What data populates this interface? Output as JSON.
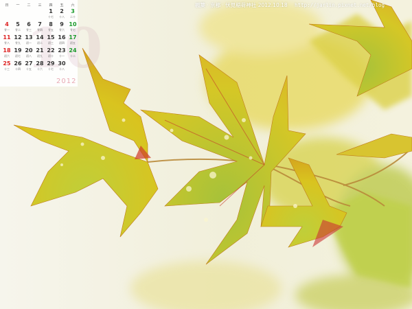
{
  "caption": {
    "location": "楓葉 · 京都 · 伏見稲荷神社",
    "date": "2012.10.18",
    "url": "http://jarlin.pixnet.net/blog"
  },
  "calendar": {
    "year": "2012",
    "weekday_headers": [
      "日",
      "一",
      "二",
      "三",
      "四",
      "五",
      "六"
    ],
    "weeks": [
      [
        null,
        null,
        null,
        null,
        {
          "day": "1",
          "sub": "十七"
        },
        {
          "day": "2",
          "sub": "十八"
        },
        {
          "day": "3",
          "sub": "二十"
        }
      ],
      [
        {
          "day": "4",
          "sub": "廿一"
        },
        {
          "day": "5",
          "sub": "廿二"
        },
        {
          "day": "6",
          "sub": "廿三"
        },
        {
          "day": "7",
          "sub": "廿四"
        },
        {
          "day": "8",
          "sub": "廿五"
        },
        {
          "day": "9",
          "sub": "廿六"
        },
        {
          "day": "10",
          "sub": "廿七"
        }
      ],
      [
        {
          "day": "11",
          "sub": "廿八"
        },
        {
          "day": "12",
          "sub": "廿九"
        },
        {
          "day": "13",
          "sub": "初一"
        },
        {
          "day": "14",
          "sub": "初二"
        },
        {
          "day": "15",
          "sub": "初三"
        },
        {
          "day": "16",
          "sub": "初四"
        },
        {
          "day": "17",
          "sub": "初五"
        }
      ],
      [
        {
          "day": "18",
          "sub": "初六"
        },
        {
          "day": "19",
          "sub": "初七"
        },
        {
          "day": "20",
          "sub": "初八"
        },
        {
          "day": "21",
          "sub": "初九"
        },
        {
          "day": "22",
          "sub": "初十"
        },
        {
          "day": "23",
          "sub": "十一"
        },
        {
          "day": "24",
          "sub": "十二"
        }
      ],
      [
        {
          "day": "25",
          "sub": "十三"
        },
        {
          "day": "26",
          "sub": "十四"
        },
        {
          "day": "27",
          "sub": "十五"
        },
        {
          "day": "28",
          "sub": "十六"
        },
        {
          "day": "29",
          "sub": "十七"
        },
        {
          "day": "30",
          "sub": "十八"
        },
        null
      ]
    ]
  },
  "colors": {
    "background": "#f4f3ea",
    "leaf_yellow": "#d8c21e",
    "leaf_green": "#9cbc1a",
    "vein_red": "#c0283a",
    "sunday": "#dd2222",
    "saturday": "#1a9a2a",
    "year_text": "#e8a9b4"
  }
}
